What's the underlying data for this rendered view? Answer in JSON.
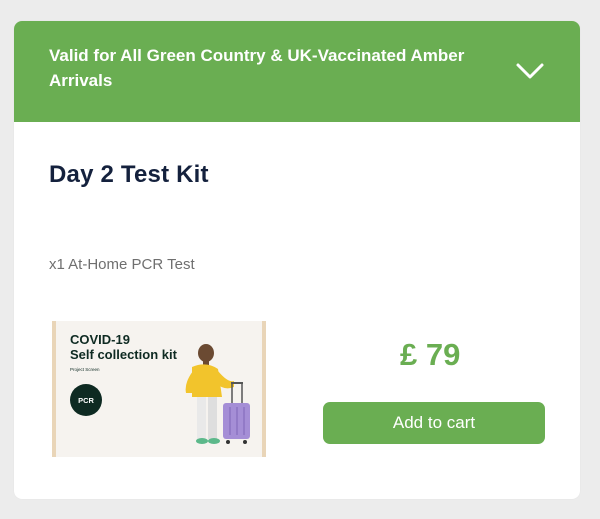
{
  "banner": {
    "text": "Valid for All Green Country & UK-Vaccinated Amber Arrivals",
    "toggle_icon": "chevron-down-icon"
  },
  "product": {
    "title": "Day 2 Test Kit",
    "subtitle": "x1 At-Home PCR Test",
    "image": {
      "heading_line1": "COVID-19",
      "heading_line2": "Self collection kit",
      "brand_text": "Project Screen",
      "badge": "PCR"
    },
    "price": "£ 79",
    "add_to_cart_label": "Add to cart"
  },
  "colors": {
    "accent_green": "#6aae52",
    "title_navy": "#14213d",
    "badge_dark_green": "#0e2a22",
    "text_grey": "#6f6f6f"
  }
}
